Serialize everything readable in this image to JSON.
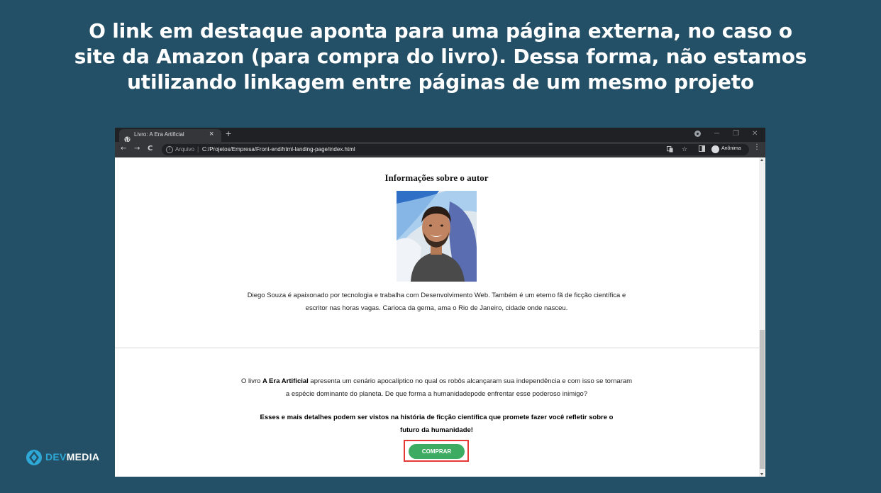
{
  "slide": {
    "title_lines": [
      "O link em destaque aponta para uma página externa, no caso o",
      "site da Amazon (para compra do livro). Dessa forma, não estamos",
      "utilizando linkagem entre páginas de um mesmo projeto"
    ]
  },
  "browser": {
    "tab_title": "Livro: A Era Artificial",
    "tab_close": "×",
    "new_tab": "+",
    "window_controls": {
      "minimize": "─",
      "maximize": "❐",
      "close": "✕"
    },
    "nav": {
      "back": "←",
      "forward": "→",
      "reload": "C"
    },
    "address": {
      "security_label": "Arquivo",
      "separator": "|",
      "url": "C:/Projetos/Empresa/Front-end/html-landing-page/index.html"
    },
    "profile_label": "Anônima",
    "menu": "⋮"
  },
  "page": {
    "author_heading": "Informações sobre o autor",
    "author_bio_line1": "Diego Souza é apaixonado por tecnologia e trabalha com Desenvolvimento Web. Também é um eterno fã de ficção científica e",
    "author_bio_line2": "escritor nas horas vagas. Carioca da gema, ama o Rio de Janeiro, cidade onde nasceu.",
    "book_desc_prefix": "O livro ",
    "book_title": "A Era Artificial",
    "book_desc_suffix": " apresenta um cenário apocalíptico no qual os robôs alcançaram sua independência e com isso se tornaram",
    "book_desc_line2": "a espécie dominante do planeta. De que forma a humanidadepode enfrentar esse poderoso inimigo?",
    "cta_line1": "Esses e mais detalhes podem ser vistos na história de ficção científica que promete fazer você refletir sobre o",
    "cta_line2": "futuro da humanidade!",
    "buy_button": "COMPRAR"
  },
  "logo": {
    "dev": "DEV",
    "media": "MEDIA"
  },
  "colors": {
    "background": "#235066",
    "button": "#3dab62",
    "highlight": "#e53935",
    "logo_accent": "#2ea8d6"
  }
}
